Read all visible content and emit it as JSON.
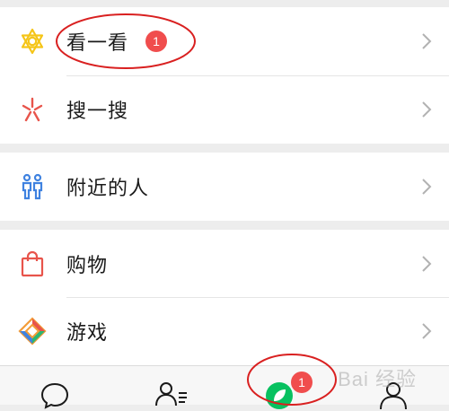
{
  "menu": {
    "items": [
      {
        "label": "看一看",
        "badge": "1",
        "icon": "kan-yi-kan-icon"
      },
      {
        "label": "搜一搜",
        "icon": "sou-yi-sou-icon"
      },
      {
        "label": "附近的人",
        "icon": "nearby-people-icon"
      },
      {
        "label": "购物",
        "icon": "shopping-bag-icon"
      },
      {
        "label": "游戏",
        "icon": "game-icon"
      }
    ]
  },
  "tabbar": {
    "discover_badge": "1",
    "tabs": [
      "chat-bubble-icon",
      "contacts-icon",
      "discover-compass-icon",
      "me-icon"
    ]
  },
  "watermark": {
    "text": "Bai 经验"
  },
  "colors": {
    "badge": "#f04d4d",
    "accent_green": "#07c160",
    "annotation_red": "#d92020",
    "background": "#ededed",
    "kan_icon": "#f5c518",
    "sou_icon": "#e8544b",
    "nearby_icon": "#3f82e0",
    "shopping_icon": "#e8544b"
  }
}
